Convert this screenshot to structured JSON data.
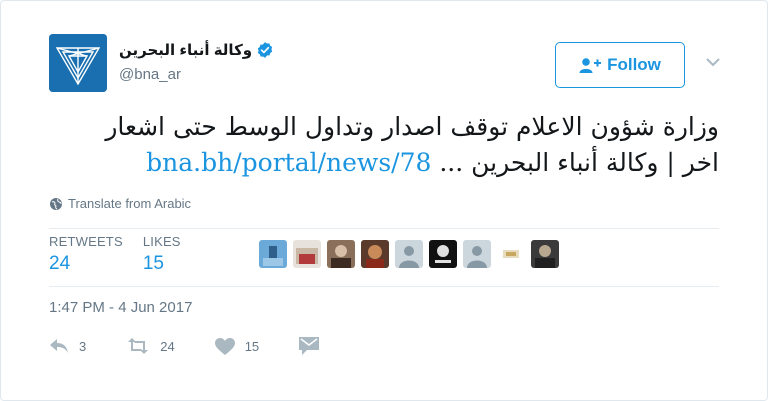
{
  "user": {
    "display_name": "وكالة أنباء البحرين",
    "handle": "@bna_ar",
    "verified": true
  },
  "follow_button": {
    "label": "Follow",
    "icon": "person-add-icon"
  },
  "tweet": {
    "line1": "وزارة شؤون الاعلام توقف اصدار وتداول الوسط حتى اشعار",
    "line2_text": "اخر | وكالة أنباء البحرين ...",
    "link": "bna.bh/portal/news/78"
  },
  "translate": {
    "label": "Translate from Arabic",
    "icon": "globe-icon"
  },
  "stats": {
    "retweets_label": "RETWEETS",
    "retweets_value": "24",
    "likes_label": "LIKES",
    "likes_value": "15"
  },
  "likers": [
    "liker-avatar-1",
    "liker-avatar-2",
    "liker-avatar-3",
    "liker-avatar-4",
    "liker-avatar-5",
    "liker-avatar-6",
    "liker-avatar-7",
    "liker-avatar-8",
    "liker-avatar-9"
  ],
  "timestamp": "1:47 PM - 4 Jun 2017",
  "actions": {
    "reply_count": "3",
    "retweet_count": "24",
    "like_count": "15"
  },
  "colors": {
    "accent": "#1b95e0",
    "muted": "#657786",
    "avatar_bg": "#1a6fb0"
  }
}
